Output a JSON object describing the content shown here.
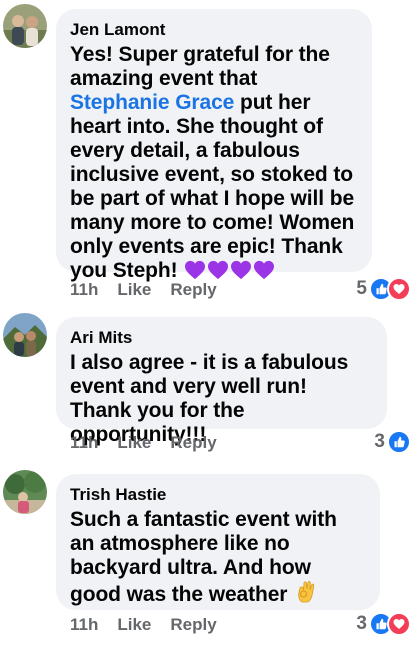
{
  "comments": [
    {
      "author": "Jen Lamont",
      "text_before": "Yes! Super grateful for the amazing event that ",
      "mention": "Stephanie Grace",
      "text_after": " put her heart into. She thought of every detail, a fabulous inclusive event, so stoked to be part of what I hope will be many more to come! Women only events are epic! Thank you Steph!",
      "emoji": "purple-heart x4",
      "time": "11h",
      "like_label": "Like",
      "reply_label": "Reply",
      "reaction_count": "5",
      "reactions": [
        "like",
        "love"
      ]
    },
    {
      "author": "Ari Mits",
      "text": "I also agree - it is a fabulous event and very well run! Thank you for the opportunity!!!",
      "time": "11h",
      "like_label": "Like",
      "reply_label": "Reply",
      "reaction_count": "3",
      "reactions": [
        "like"
      ]
    },
    {
      "author": "Trish Hastie",
      "text": "Such a fantastic event with an atmosphere like no backyard ultra. And how good was the weather",
      "emoji": "ok-hand",
      "time": "11h",
      "like_label": "Like",
      "reply_label": "Reply",
      "reaction_count": "3",
      "reactions": [
        "like",
        "love"
      ]
    }
  ],
  "colors": {
    "bubble": "#f0f2f5",
    "mention": "#1b74e4",
    "meta": "#65676b",
    "like": "#1877f2",
    "love": "#f33e58",
    "purple_heart": "#9b33e6"
  }
}
